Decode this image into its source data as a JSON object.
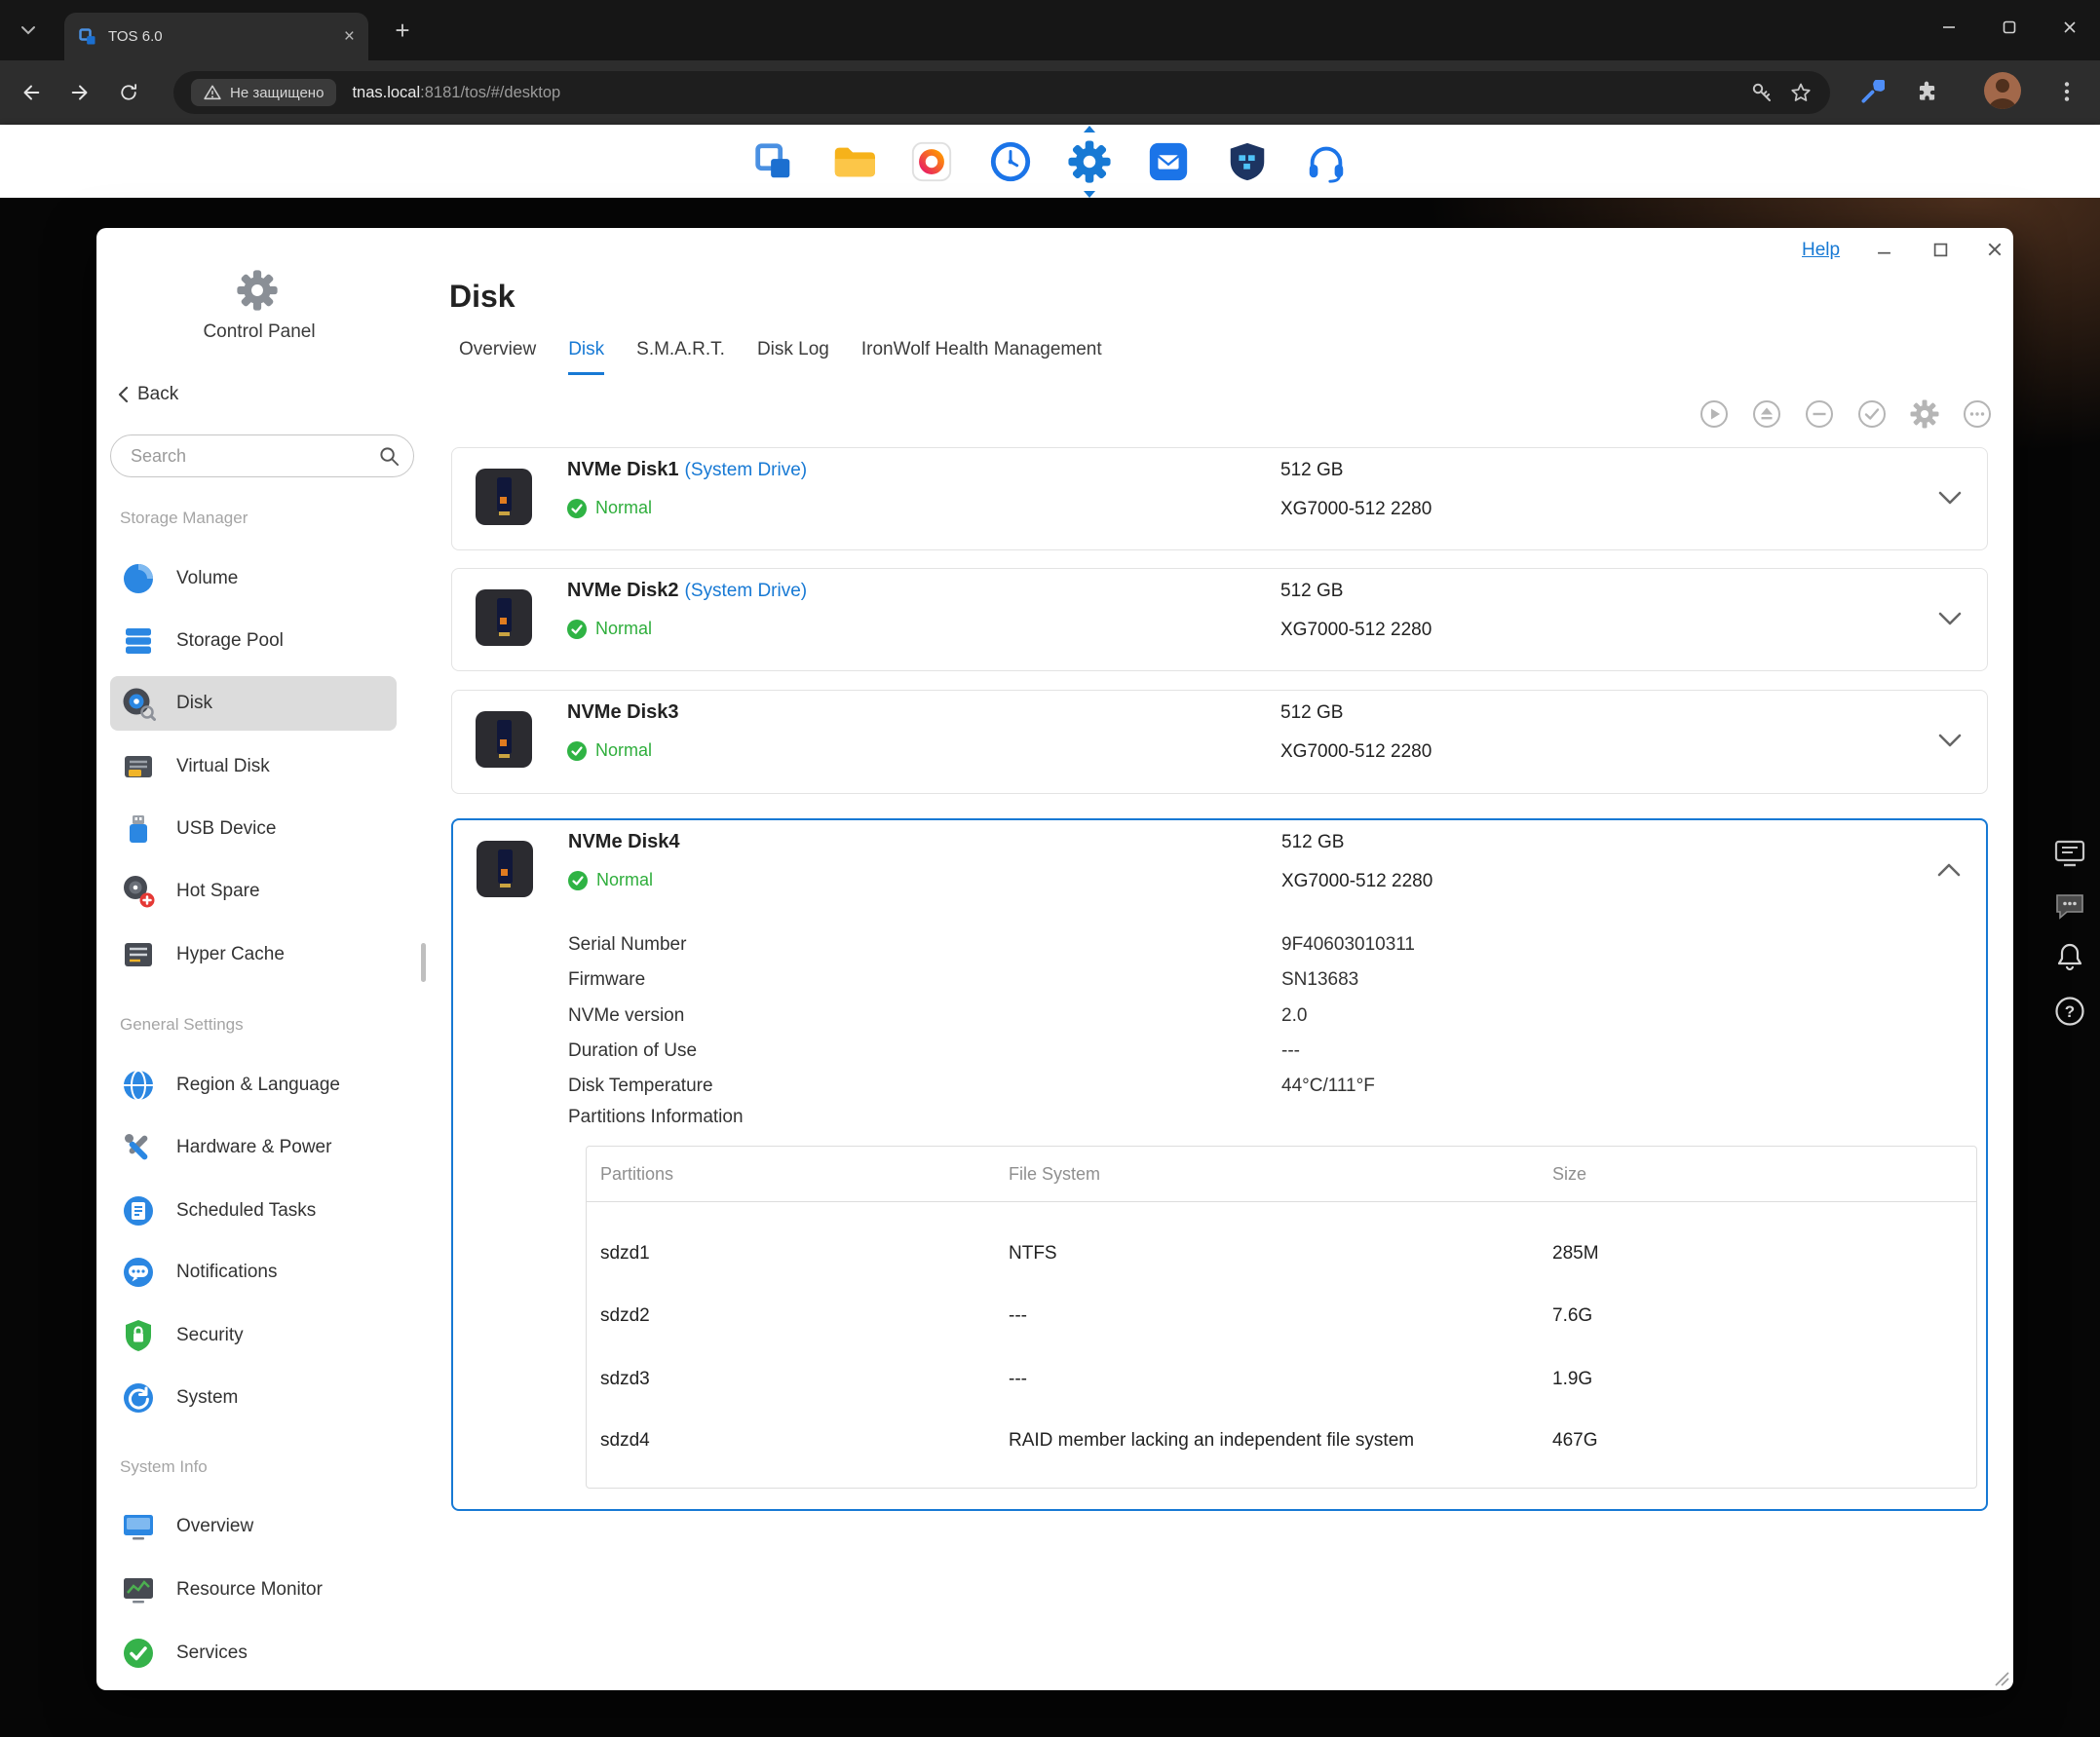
{
  "colors": {
    "accent": "#1779d4",
    "success": "#2fb344"
  },
  "browser": {
    "tab_title": "TOS 6.0",
    "security_label": "Не защищено",
    "url_host": "tnas.local",
    "url_path": ":8181/tos/#/desktop"
  },
  "taskbar_icons": [
    {
      "name": "tos-logo-icon"
    },
    {
      "name": "file-manager-icon"
    },
    {
      "name": "gallery-icon"
    },
    {
      "name": "backup-clock-icon"
    },
    {
      "name": "control-panel-icon",
      "active": true
    },
    {
      "name": "app-center-icon"
    },
    {
      "name": "docker-icon"
    },
    {
      "name": "support-headset-icon"
    }
  ],
  "desktop_side_icons": [
    {
      "name": "remote-display-icon"
    },
    {
      "name": "chat-icon"
    },
    {
      "name": "notification-bell-icon"
    },
    {
      "name": "help-circle-icon"
    }
  ],
  "window": {
    "help_label": "Help",
    "control_panel_label": "Control Panel",
    "back_label": "Back",
    "search_placeholder": "Search",
    "sections": [
      {
        "label": "Storage Manager",
        "items": [
          {
            "label": "Volume"
          },
          {
            "label": "Storage Pool"
          },
          {
            "label": "Disk",
            "selected": true
          },
          {
            "label": "Virtual Disk"
          },
          {
            "label": "USB Device"
          },
          {
            "label": "Hot Spare"
          },
          {
            "label": "Hyper Cache"
          }
        ]
      },
      {
        "label": "General Settings",
        "items": [
          {
            "label": "Region & Language"
          },
          {
            "label": "Hardware & Power"
          },
          {
            "label": "Scheduled Tasks"
          },
          {
            "label": "Notifications"
          },
          {
            "label": "Security"
          },
          {
            "label": "System"
          }
        ]
      },
      {
        "label": "System Info",
        "items": [
          {
            "label": "Overview"
          },
          {
            "label": "Resource Monitor"
          },
          {
            "label": "Services"
          }
        ]
      }
    ],
    "page": {
      "title": "Disk",
      "tabs": [
        {
          "label": "Overview"
        },
        {
          "label": "Disk",
          "active": true
        },
        {
          "label": "S.M.A.R.T."
        },
        {
          "label": "Disk Log"
        },
        {
          "label": "IronWolf Health Management"
        }
      ]
    },
    "disks": [
      {
        "name": "NVMe Disk1",
        "system_drive": "(System Drive)",
        "status": "Normal",
        "size": "512 GB",
        "model": "XG7000-512 2280"
      },
      {
        "name": "NVMe Disk2",
        "system_drive": "(System Drive)",
        "status": "Normal",
        "size": "512 GB",
        "model": "XG7000-512 2280"
      },
      {
        "name": "NVMe Disk3",
        "system_drive": "",
        "status": "Normal",
        "size": "512 GB",
        "model": "XG7000-512 2280"
      },
      {
        "name": "NVMe Disk4",
        "system_drive": "",
        "status": "Normal",
        "size": "512 GB",
        "model": "XG7000-512 2280"
      }
    ],
    "disk4_details": {
      "rows": [
        {
          "label": "Serial Number",
          "value": "9F40603010311"
        },
        {
          "label": "Firmware",
          "value": "SN13683"
        },
        {
          "label": "NVMe version",
          "value": "2.0"
        },
        {
          "label": "Duration of Use",
          "value": "---"
        },
        {
          "label": "Disk Temperature",
          "value": "44°C/111°F"
        }
      ],
      "partitions_title": "Partitions Information",
      "partitions_table": {
        "headers": [
          "Partitions",
          "File System",
          "Size"
        ],
        "rows": [
          [
            "sdzd1",
            "NTFS",
            "285M"
          ],
          [
            "sdzd2",
            "---",
            "7.6G"
          ],
          [
            "sdzd3",
            "---",
            "1.9G"
          ],
          [
            "sdzd4",
            "RAID member lacking an independent file system",
            "467G"
          ]
        ]
      }
    }
  }
}
